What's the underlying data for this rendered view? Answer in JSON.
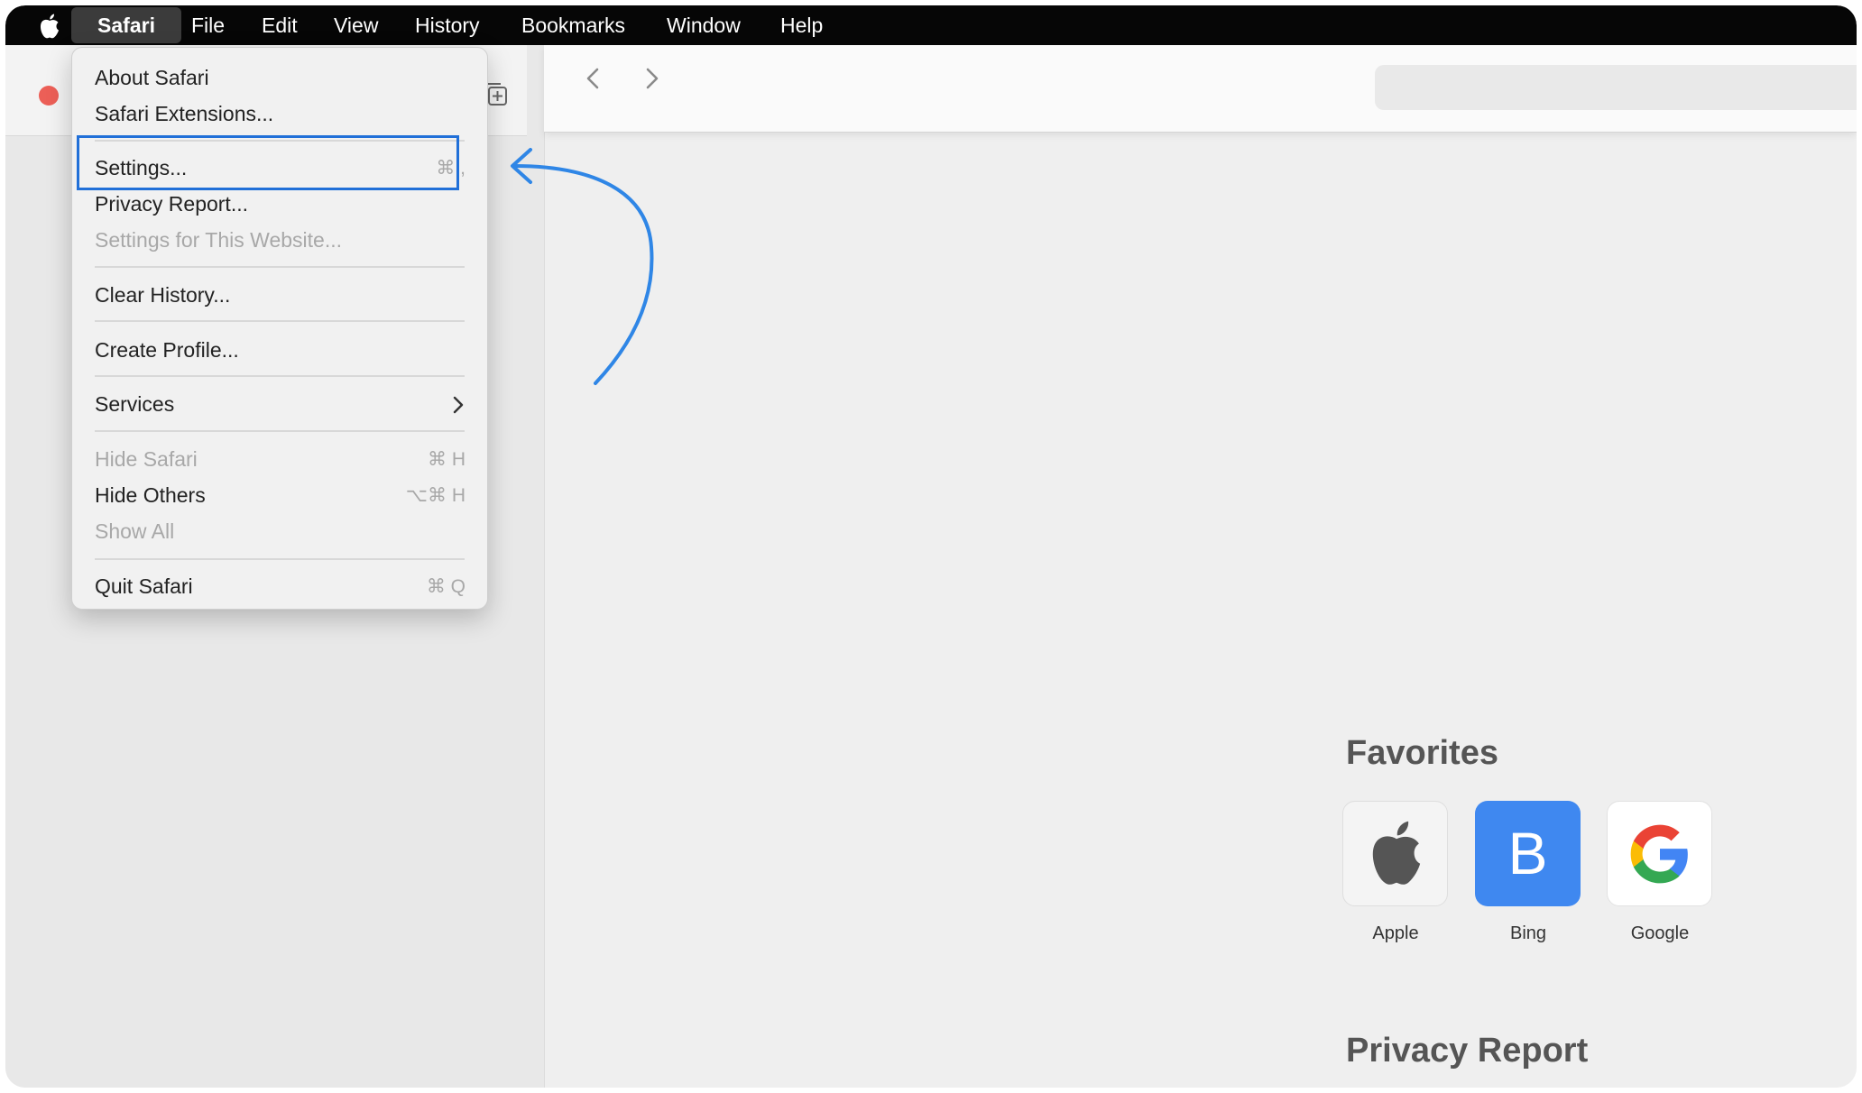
{
  "menubar": {
    "apple_icon": "apple-logo-icon",
    "items": [
      "Safari",
      "File",
      "Edit",
      "View",
      "History",
      "Bookmarks",
      "Window",
      "Help"
    ]
  },
  "safari_menu": {
    "about": "About Safari",
    "extensions": "Safari Extensions...",
    "settings": "Settings...",
    "settings_shortcut": "⌘ ,",
    "privacy_report": "Privacy Report...",
    "settings_website": "Settings for This Website...",
    "clear_history": "Clear History...",
    "create_profile": "Create Profile...",
    "services": "Services",
    "hide_safari": "Hide Safari",
    "hide_safari_shortcut": "⌘ H",
    "hide_others": "Hide Others",
    "hide_others_shortcut": "⌥⌘ H",
    "show_all": "Show All",
    "quit": "Quit Safari",
    "quit_shortcut": "⌘ Q"
  },
  "start_page": {
    "favorites_heading": "Favorites",
    "favorites": [
      {
        "label": "Apple",
        "icon": "apple-logo-icon"
      },
      {
        "label": "Bing",
        "letter": "B",
        "color": "#3f88f0"
      },
      {
        "label": "Google",
        "icon": "google-g-icon"
      }
    ],
    "privacy_heading": "Privacy Report"
  },
  "colors": {
    "highlight": "#2170d8",
    "annotation_arrow": "#2f86e6",
    "close_button": "#ec5f57"
  }
}
